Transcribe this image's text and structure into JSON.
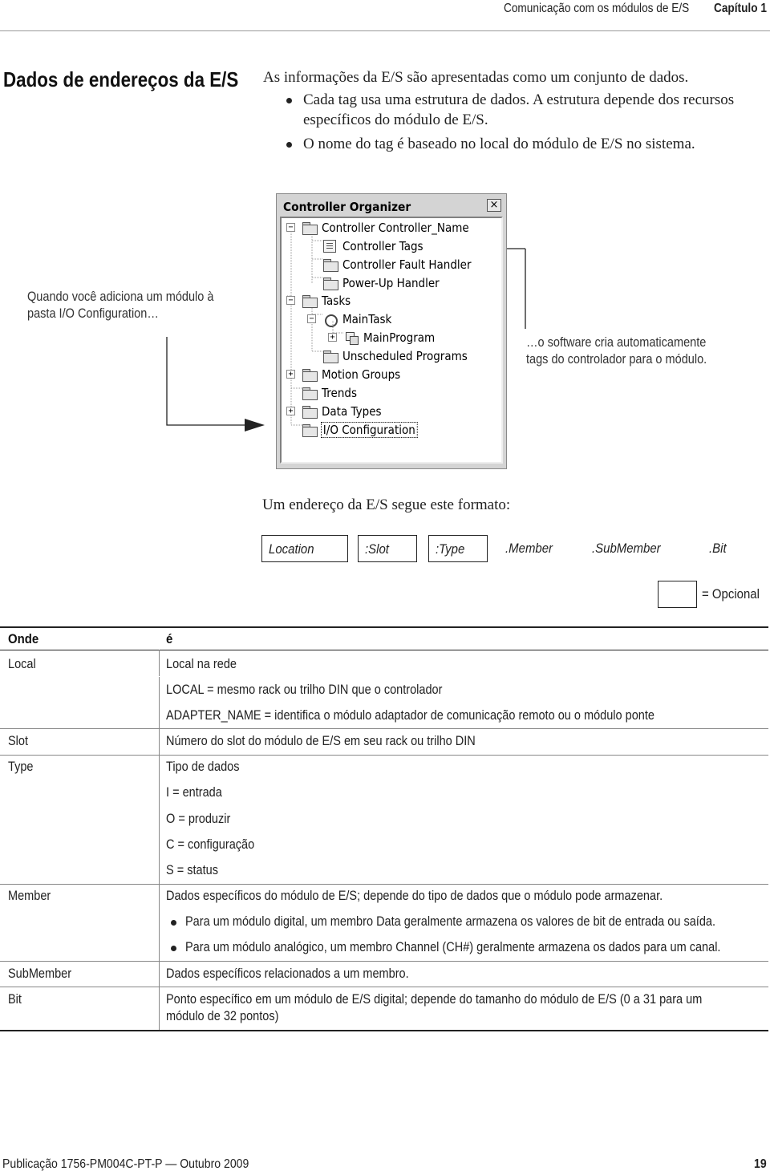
{
  "header": {
    "running_title": "Comunicação com os módulos de E/S",
    "chapter": "Capítulo 1"
  },
  "section": {
    "title": "Dados de endereços da E/S",
    "intro": "As informações da E/S são apresentadas como um conjunto de dados.",
    "bullets": [
      "Cada tag usa uma estrutura de dados. A estrutura depende dos recursos específicos do módulo de E/S.",
      "O nome do tag é baseado no local do módulo de E/S no sistema."
    ]
  },
  "figure": {
    "callout_left": [
      "Quando você adiciona um módulo à",
      "pasta I/O Configuration…"
    ],
    "callout_right": [
      "…o software cria automaticamente",
      "tags do controlador para o módulo."
    ],
    "window": {
      "title": "Controller Organizer",
      "close_glyph": "×",
      "tree": [
        {
          "label": "Controller Controller_Name",
          "expander": "−",
          "icon": "folder-icon"
        },
        {
          "label": "Controller Tags",
          "icon": "tags-icon"
        },
        {
          "label": "Controller Fault Handler",
          "icon": "folder-icon"
        },
        {
          "label": "Power-Up Handler",
          "icon": "folder-icon"
        },
        {
          "label": "Tasks",
          "expander": "−",
          "icon": "folder-icon"
        },
        {
          "label": "MainTask",
          "expander": "−",
          "icon": "task-icon"
        },
        {
          "label": "MainProgram",
          "expander": "+",
          "icon": "program-icon"
        },
        {
          "label": "Unscheduled Programs",
          "icon": "folder-icon"
        },
        {
          "label": "Motion Groups",
          "expander": "+",
          "icon": "folder-icon"
        },
        {
          "label": "Trends",
          "icon": "folder-icon"
        },
        {
          "label": "Data Types",
          "expander": "+",
          "icon": "folder-icon"
        },
        {
          "label": "I/O Configuration",
          "icon": "folder-icon",
          "selected": true
        }
      ]
    }
  },
  "address_format": {
    "title": "Um endereço da E/S segue este formato:",
    "parts": [
      {
        "label": "Location",
        "optional": false
      },
      {
        "label": ":Slot",
        "optional": false
      },
      {
        "label": ":Type",
        "optional": false
      },
      {
        "label": ".Member",
        "optional": true
      },
      {
        "label": ".SubMember",
        "optional": true
      },
      {
        "label": ".Bit",
        "optional": true
      }
    ],
    "legend": "= Opcional"
  },
  "table": {
    "headers": [
      "Onde",
      "é"
    ],
    "rows": [
      {
        "term": "Local",
        "lines": [
          "Local na rede",
          "LOCAL = mesmo rack ou trilho DIN que o controlador",
          "ADAPTER_NAME = identifica o módulo adaptador de comunicação remoto ou o módulo ponte"
        ]
      },
      {
        "term": "Slot",
        "lines": [
          "Número do slot do módulo de E/S em seu rack ou trilho DIN"
        ]
      },
      {
        "term": "Type",
        "lines": [
          "Tipo de dados",
          "I = entrada",
          "O = produzir",
          "C = configuração",
          "S = status"
        ]
      },
      {
        "term": "Member",
        "lines": [
          "Dados específicos do módulo de E/S; depende do tipo de dados que o módulo pode armazenar."
        ],
        "bullets": [
          "Para um módulo digital, um membro Data geralmente armazena os valores de bit de entrada ou saída.",
          "Para um módulo analógico, um membro Channel (CH#) geralmente armazena os dados para um canal."
        ]
      },
      {
        "term": "SubMember",
        "lines": [
          "Dados específicos relacionados a um membro."
        ]
      },
      {
        "term": "Bit",
        "lines": [
          "Ponto específico em um módulo de E/S digital; depende do tamanho do módulo de E/S (0 a 31 para um",
          "módulo de 32 pontos)"
        ]
      }
    ]
  },
  "footer": {
    "publication": "Publicação 1756-PM004C-PT-P — Outubro 2009",
    "page_number": "19"
  }
}
